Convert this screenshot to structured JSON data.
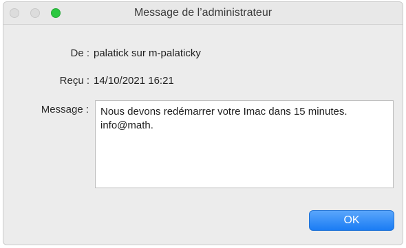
{
  "window": {
    "title": "Message de l’administrateur",
    "traffic_lights": [
      "close-icon",
      "minimize-icon",
      "zoom-icon"
    ],
    "zoom_color": "#2bc840"
  },
  "fields": {
    "from_label": "De :",
    "from_value": "palatick sur m-palaticky",
    "received_label": "Reçu :",
    "received_value": "14/10/2021 16:21",
    "message_label": "Message :",
    "message_value": "Nous devons redémarrer votre Imac dans 15 minutes. info@math."
  },
  "buttons": {
    "ok_label": "OK",
    "ok_color": "#1a7cf4"
  }
}
